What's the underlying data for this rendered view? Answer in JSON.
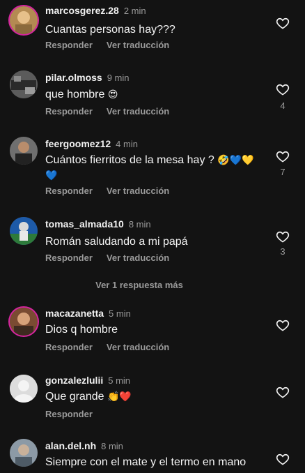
{
  "comments": [
    {
      "username": "marcosgerez.28",
      "time": "2 min",
      "text": "Cuantas personas hay???",
      "reply_label": "Responder",
      "translate_label": "Ver traducción",
      "likes": ""
    },
    {
      "username": "pilar.olmoss",
      "time": "9 min",
      "text": "que hombre",
      "emoji": "😍",
      "reply_label": "Responder",
      "translate_label": "Ver traducción",
      "likes": "4"
    },
    {
      "username": "feergoomez12",
      "time": "4 min",
      "text": "Cuántos fierritos de la mesa hay ?",
      "emoji": "🤣💙💛",
      "emoji2": "💙",
      "reply_label": "Responder",
      "translate_label": "Ver traducción",
      "likes": "7"
    },
    {
      "username": "tomas_almada10",
      "time": "8 min",
      "text": "Román saludando a mi papá",
      "reply_label": "Responder",
      "translate_label": "Ver traducción",
      "likes": "3"
    },
    {
      "username": "macazanetta",
      "time": "5 min",
      "text": "Dios q hombre",
      "reply_label": "Responder",
      "translate_label": "Ver traducción",
      "likes": ""
    },
    {
      "username": "gonzalezlulii",
      "time": "5 min",
      "text": "Que grande",
      "emoji": "👏❤️",
      "reply_label": "Responder",
      "likes": ""
    },
    {
      "username": "alan.del.nh",
      "time": "8 min",
      "text": "Siempre con el mate y el termo en mano",
      "likes": ""
    }
  ],
  "more_replies_label": "Ver 1 respuesta más",
  "colors": {
    "background": "#131313",
    "secondary_text": "#9a9a9a",
    "primary_text": "#f5f5f5"
  }
}
